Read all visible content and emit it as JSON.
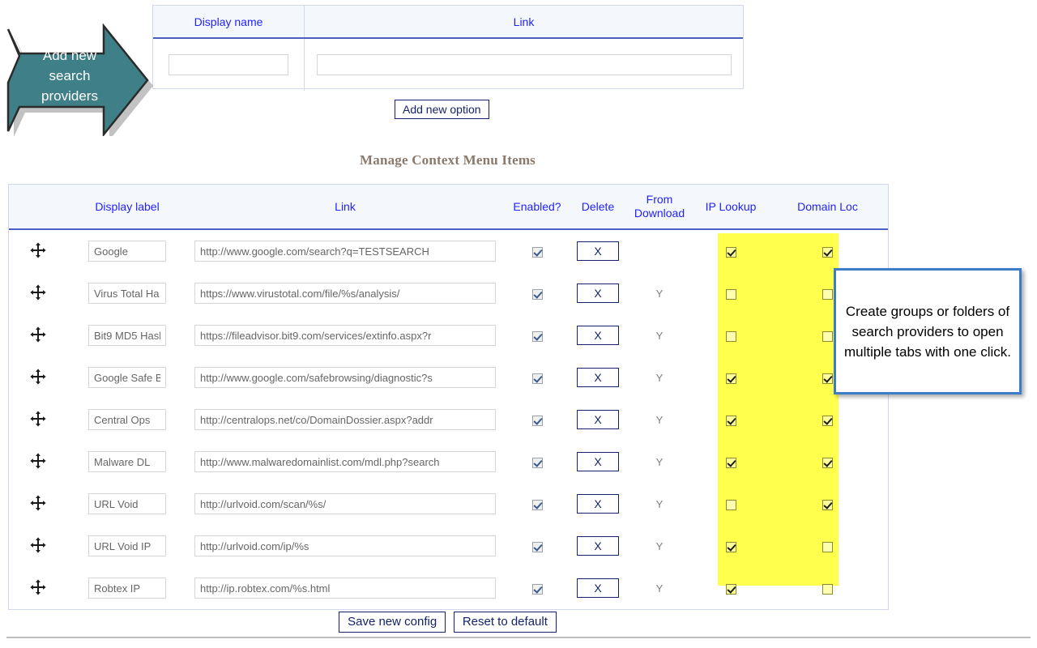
{
  "callouts": {
    "arrow": {
      "text": "Add new search providers",
      "lines": [
        "Add new",
        "search",
        "providers"
      ],
      "fill": "#3f7f87",
      "stroke": "#2b2b2b"
    },
    "tip": {
      "text": "Create groups or folders of search providers to open multiple tabs with one click.",
      "border_color": "#3d7cc9"
    }
  },
  "add_form": {
    "headers": [
      "Display name",
      "Link"
    ],
    "name_value": "",
    "name_placeholder": "",
    "link_value": "",
    "link_placeholder": "",
    "add_button": "Add new option"
  },
  "section": {
    "title": "Manage Context Menu Items"
  },
  "table": {
    "headers": [
      "",
      "Display label",
      "Link",
      "Enabled?",
      "Delete",
      "From Download",
      "IP Lookup",
      "Domain Loc"
    ],
    "delete_label": "X",
    "from_download_yes": "Y",
    "highlight_color": "#ffff4d",
    "rows": [
      {
        "handle": "move-handle",
        "label": "Google",
        "link": "http://www.google.com/search?q=TESTSEARCH",
        "enabled": true,
        "delete": "X",
        "from_download": "",
        "ip_lookup": true,
        "domain_loc": true
      },
      {
        "handle": "move-handle",
        "label": "Virus Total Ha",
        "link": "https://www.virustotal.com/file/%s/analysis/",
        "enabled": true,
        "delete": "X",
        "from_download": "Y",
        "ip_lookup": false,
        "domain_loc": false
      },
      {
        "handle": "move-handle",
        "label": "Bit9 MD5 Hasl",
        "link": "https://fileadvisor.bit9.com/services/extinfo.aspx?r",
        "enabled": true,
        "delete": "X",
        "from_download": "Y",
        "ip_lookup": false,
        "domain_loc": false
      },
      {
        "handle": "move-handle",
        "label": "Google Safe B",
        "link": "http://www.google.com/safebrowsing/diagnostic?s",
        "enabled": true,
        "delete": "X",
        "from_download": "Y",
        "ip_lookup": true,
        "domain_loc": true
      },
      {
        "handle": "move-handle",
        "label": "Central Ops",
        "link": "http://centralops.net/co/DomainDossier.aspx?addr",
        "enabled": true,
        "delete": "X",
        "from_download": "Y",
        "ip_lookup": true,
        "domain_loc": true
      },
      {
        "handle": "move-handle",
        "label": "Malware DL",
        "link": "http://www.malwaredomainlist.com/mdl.php?search",
        "enabled": true,
        "delete": "X",
        "from_download": "Y",
        "ip_lookup": true,
        "domain_loc": true
      },
      {
        "handle": "move-handle",
        "label": "URL Void",
        "link": "http://urlvoid.com/scan/%s/",
        "enabled": true,
        "delete": "X",
        "from_download": "Y",
        "ip_lookup": false,
        "domain_loc": true
      },
      {
        "handle": "move-handle",
        "label": "URL Void IP",
        "link": "http://urlvoid.com/ip/%s",
        "enabled": true,
        "delete": "X",
        "from_download": "Y",
        "ip_lookup": true,
        "domain_loc": false
      },
      {
        "handle": "move-handle",
        "label": "Robtex IP",
        "link": "http://ip.robtex.com/%s.html",
        "enabled": true,
        "delete": "X",
        "from_download": "Y",
        "ip_lookup": true,
        "domain_loc": false
      }
    ]
  },
  "footer": {
    "save_label": "Save new config",
    "reset_label": "Reset to default"
  }
}
